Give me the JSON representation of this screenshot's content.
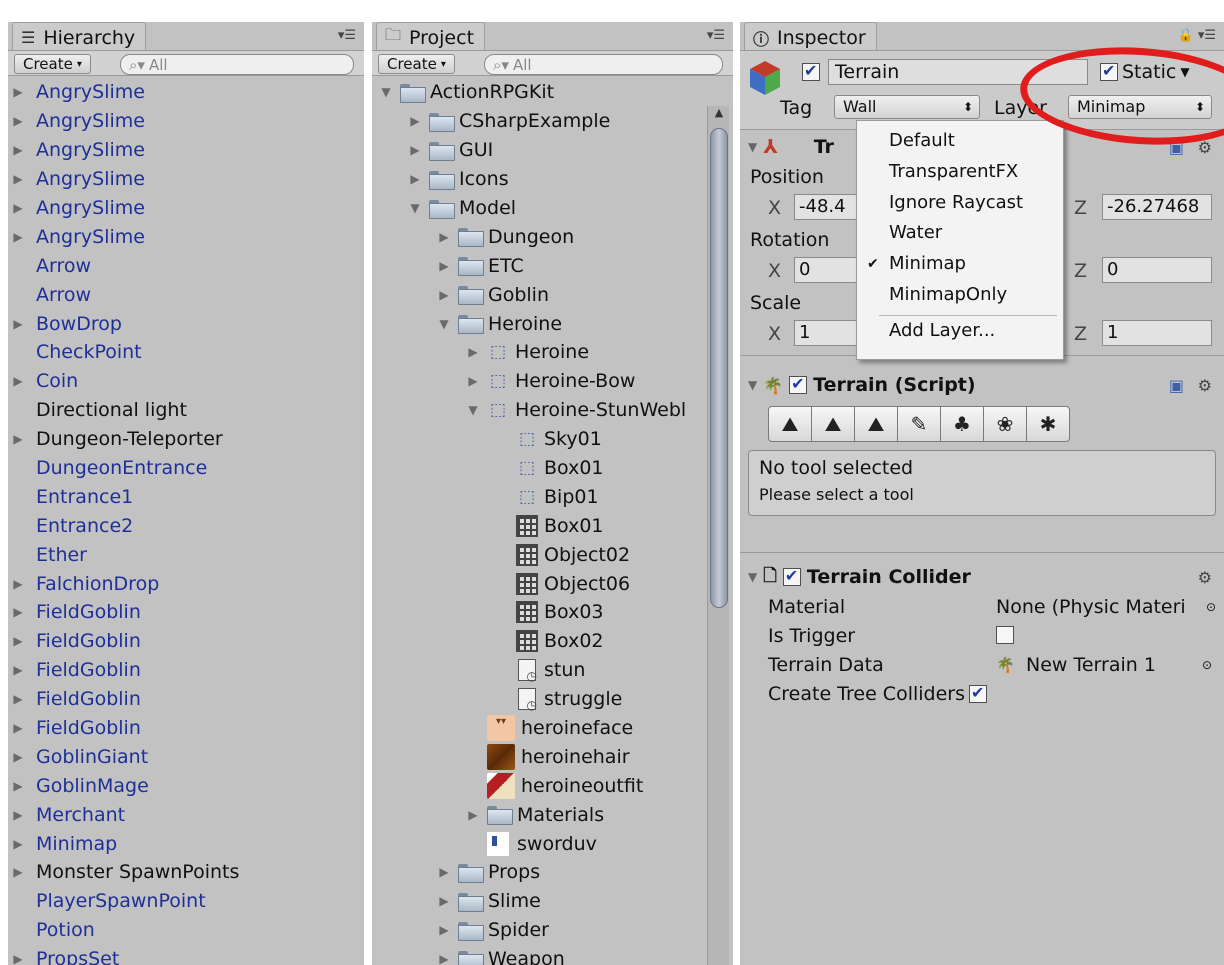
{
  "hierarchy": {
    "tab_title": "Hierarchy",
    "create_label": "Create",
    "search_placeholder": "All",
    "items": [
      {
        "label": "AngrySlime",
        "arrow": "▶",
        "color": "blue"
      },
      {
        "label": "AngrySlime",
        "arrow": "▶",
        "color": "blue"
      },
      {
        "label": "AngrySlime",
        "arrow": "▶",
        "color": "blue"
      },
      {
        "label": "AngrySlime",
        "arrow": "▶",
        "color": "blue"
      },
      {
        "label": "AngrySlime",
        "arrow": "▶",
        "color": "blue"
      },
      {
        "label": "AngrySlime",
        "arrow": "▶",
        "color": "blue"
      },
      {
        "label": "Arrow",
        "arrow": "",
        "color": "blue"
      },
      {
        "label": "Arrow",
        "arrow": "",
        "color": "blue"
      },
      {
        "label": "BowDrop",
        "arrow": "▶",
        "color": "blue"
      },
      {
        "label": "CheckPoint",
        "arrow": "",
        "color": "blue"
      },
      {
        "label": "Coin",
        "arrow": "▶",
        "color": "blue"
      },
      {
        "label": "Directional light",
        "arrow": "",
        "color": "black"
      },
      {
        "label": "Dungeon-Teleporter",
        "arrow": "▶",
        "color": "black"
      },
      {
        "label": "DungeonEntrance",
        "arrow": "",
        "color": "blue"
      },
      {
        "label": "Entrance1",
        "arrow": "",
        "color": "blue"
      },
      {
        "label": "Entrance2",
        "arrow": "",
        "color": "blue"
      },
      {
        "label": "Ether",
        "arrow": "",
        "color": "blue"
      },
      {
        "label": "FalchionDrop",
        "arrow": "▶",
        "color": "blue"
      },
      {
        "label": "FieldGoblin",
        "arrow": "▶",
        "color": "blue"
      },
      {
        "label": "FieldGoblin",
        "arrow": "▶",
        "color": "blue"
      },
      {
        "label": "FieldGoblin",
        "arrow": "▶",
        "color": "blue"
      },
      {
        "label": "FieldGoblin",
        "arrow": "▶",
        "color": "blue"
      },
      {
        "label": "FieldGoblin",
        "arrow": "▶",
        "color": "blue"
      },
      {
        "label": "GoblinGiant",
        "arrow": "▶",
        "color": "blue"
      },
      {
        "label": "GoblinMage",
        "arrow": "▶",
        "color": "blue"
      },
      {
        "label": "Merchant",
        "arrow": "▶",
        "color": "blue"
      },
      {
        "label": "Minimap",
        "arrow": "▶",
        "color": "blue"
      },
      {
        "label": "Monster SpawnPoints",
        "arrow": "▶",
        "color": "black"
      },
      {
        "label": "PlayerSpawnPoint",
        "arrow": "",
        "color": "blue"
      },
      {
        "label": "Potion",
        "arrow": "",
        "color": "blue"
      },
      {
        "label": "PropsSet",
        "arrow": "▶",
        "color": "blue"
      }
    ]
  },
  "project": {
    "tab_title": "Project",
    "create_label": "Create",
    "search_placeholder": "All",
    "items": [
      {
        "label": "ActionRPGKit",
        "arrow": "▼",
        "indent": 0,
        "icon": "folder"
      },
      {
        "label": "CSharpExample",
        "arrow": "▶",
        "indent": 1,
        "icon": "folder"
      },
      {
        "label": "GUI",
        "arrow": "▶",
        "indent": 1,
        "icon": "folder"
      },
      {
        "label": "Icons",
        "arrow": "▶",
        "indent": 1,
        "icon": "folder"
      },
      {
        "label": "Model",
        "arrow": "▼",
        "indent": 1,
        "icon": "folder"
      },
      {
        "label": "Dungeon",
        "arrow": "▶",
        "indent": 2,
        "icon": "folder"
      },
      {
        "label": "ETC",
        "arrow": "▶",
        "indent": 2,
        "icon": "folder"
      },
      {
        "label": "Goblin",
        "arrow": "▶",
        "indent": 2,
        "icon": "folder"
      },
      {
        "label": "Heroine",
        "arrow": "▼",
        "indent": 2,
        "icon": "folder"
      },
      {
        "label": "Heroine",
        "arrow": "▶",
        "indent": 3,
        "icon": "prefab"
      },
      {
        "label": "Heroine-Bow",
        "arrow": "▶",
        "indent": 3,
        "icon": "prefab"
      },
      {
        "label": "Heroine-StunWebl",
        "arrow": "▼",
        "indent": 3,
        "icon": "prefab"
      },
      {
        "label": "Sky01",
        "arrow": "",
        "indent": 4,
        "icon": "prefab"
      },
      {
        "label": "Box01",
        "arrow": "",
        "indent": 4,
        "icon": "prefab"
      },
      {
        "label": "Bip01",
        "arrow": "",
        "indent": 4,
        "icon": "prefab"
      },
      {
        "label": "Box01",
        "arrow": "",
        "indent": 4,
        "icon": "mesh"
      },
      {
        "label": "Object02",
        "arrow": "",
        "indent": 4,
        "icon": "mesh"
      },
      {
        "label": "Object06",
        "arrow": "",
        "indent": 4,
        "icon": "mesh"
      },
      {
        "label": "Box03",
        "arrow": "",
        "indent": 4,
        "icon": "mesh"
      },
      {
        "label": "Box02",
        "arrow": "",
        "indent": 4,
        "icon": "mesh"
      },
      {
        "label": "stun",
        "arrow": "",
        "indent": 4,
        "icon": "anim"
      },
      {
        "label": "struggle",
        "arrow": "",
        "indent": 4,
        "icon": "anim"
      },
      {
        "label": "heroineface",
        "arrow": "",
        "indent": 3,
        "icon": "tex-face"
      },
      {
        "label": "heroinehair",
        "arrow": "",
        "indent": 3,
        "icon": "tex-hair"
      },
      {
        "label": "heroineoutfit",
        "arrow": "",
        "indent": 3,
        "icon": "tex-outfit"
      },
      {
        "label": "Materials",
        "arrow": "▶",
        "indent": 3,
        "icon": "folder"
      },
      {
        "label": "sworduv",
        "arrow": "",
        "indent": 3,
        "icon": "sworduv"
      },
      {
        "label": "Props",
        "arrow": "▶",
        "indent": 2,
        "icon": "folder"
      },
      {
        "label": "Slime",
        "arrow": "▶",
        "indent": 2,
        "icon": "folder"
      },
      {
        "label": "Spider",
        "arrow": "▶",
        "indent": 2,
        "icon": "folder"
      },
      {
        "label": "Weapon",
        "arrow": "▶",
        "indent": 2,
        "icon": "folder"
      }
    ]
  },
  "inspector": {
    "tab_title": "Inspector",
    "object_name": "Terrain",
    "static_label": "Static",
    "tag_label": "Tag",
    "tag_value": "Wall",
    "layer_label": "Layer",
    "layer_value": "Minimap",
    "transform": {
      "title": "Tr",
      "position_label": "Position",
      "rotation_label": "Rotation",
      "scale_label": "Scale",
      "pos_x": "-48.4",
      "pos_z": "-26.27468",
      "rot_x": "0",
      "rot_z": "0",
      "scale_x": "1",
      "scale_z": "1",
      "x_label": "X",
      "z_label": "Z"
    },
    "terrain_script": {
      "title": "Terrain (Script)",
      "help_title": "No tool selected",
      "help_text": "Please select a tool"
    },
    "terrain_collider": {
      "title": "Terrain Collider",
      "material_label": "Material",
      "material_value": "None (Physic Materi",
      "is_trigger_label": "Is Trigger",
      "terrain_data_label": "Terrain Data",
      "terrain_data_value": "New Terrain 1",
      "create_tree_colliders_label": "Create Tree Colliders"
    }
  },
  "layer_dropdown": {
    "options": [
      "Default",
      "TransparentFX",
      "Ignore Raycast",
      "Water",
      "Minimap",
      "MinimapOnly"
    ],
    "selected": "Minimap",
    "add_layer_label": "Add Layer..."
  },
  "colors": {
    "panel_bg": "#c2c2c2",
    "prefab_text": "#1e2f96",
    "annotation_ring": "#e01c1c"
  }
}
